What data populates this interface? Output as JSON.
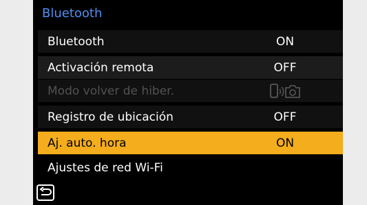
{
  "header": {
    "title": "Bluetooth"
  },
  "menu": {
    "items": [
      {
        "label": "Bluetooth",
        "value": "ON"
      },
      {
        "label": "Activación remota",
        "value": "OFF"
      },
      {
        "label": "Modo volver de hiber.",
        "value_icon": "phone-camera-link-icon",
        "disabled": true
      },
      {
        "label": "Registro de ubicación",
        "value": "OFF"
      },
      {
        "label": "Aj. auto. hora",
        "value": "ON",
        "selected": true
      },
      {
        "label": "Ajustes de red Wi-Fi",
        "value": ""
      }
    ]
  },
  "footer": {
    "back_icon": "return-arrow-icon"
  },
  "colors": {
    "title": "#4f8ff0",
    "selected_row": "#f4ad1c",
    "disabled_text": "#525252",
    "screen_background": "#000000",
    "page_background": "#ececec"
  }
}
